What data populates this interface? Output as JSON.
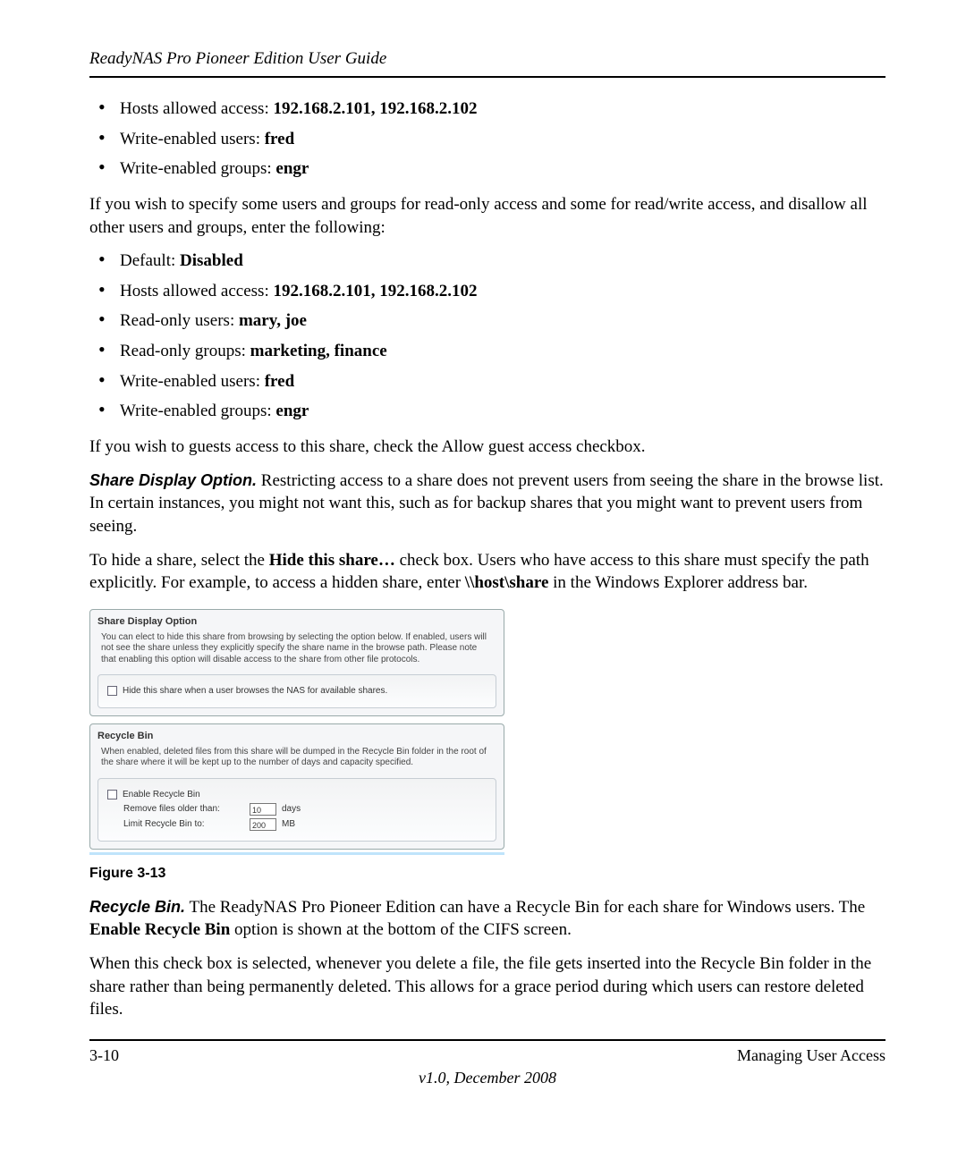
{
  "header": "ReadyNAS Pro Pioneer Edition User Guide",
  "list1": [
    {
      "label": "Hosts allowed access: ",
      "value": "192.168.2.101, 192.168.2.102"
    },
    {
      "label": "Write-enabled users: ",
      "value": "fred"
    },
    {
      "label": "Write-enabled groups: ",
      "value": "engr"
    }
  ],
  "para1": "If you wish to specify some users and groups for read-only access and some for read/write access, and disallow all other users and groups, enter the following:",
  "list2": [
    {
      "label": "Default: ",
      "value": "Disabled"
    },
    {
      "label": "Hosts allowed access: ",
      "value": "192.168.2.101, 192.168.2.102"
    },
    {
      "label": "Read-only users: ",
      "value": "mary, joe"
    },
    {
      "label": "Read-only groups: ",
      "value": "marketing, finance"
    },
    {
      "label": "Write-enabled users: ",
      "value": "fred"
    },
    {
      "label": "Write-enabled groups: ",
      "value": "engr"
    }
  ],
  "para2": "If you wish to guests access to this share, check the Allow guest access checkbox.",
  "share_head": "Share Display Option.",
  "share_body": " Restricting access to a share does not prevent users from seeing the share in the browse list. In certain instances, you might not want this, such as for backup shares that you might want to prevent users from seeing.",
  "hide_para_pre": "To hide a share, select the ",
  "hide_bold": "Hide this share…",
  "hide_para_mid": " check box. Users who have access to this share must specify the path explicitly. For example, to access a hidden share, enter ",
  "hide_path": "\\\\host\\share",
  "hide_para_post": " in the Windows Explorer address bar.",
  "figure": {
    "sdo_title": "Share Display Option",
    "sdo_desc": "You can elect to hide this share from browsing by selecting the option below. If enabled, users will not see the share unless they explicitly specify the share name in the browse path. Please note that enabling this option will disable access to the share from other file protocols.",
    "sdo_check": "Hide this share when a user browses the NAS for available shares.",
    "rb_title": "Recycle Bin",
    "rb_desc": "When enabled, deleted files from this share will be dumped in the Recycle Bin folder in the root of the share where it will be kept up to the number of days and capacity specified.",
    "rb_check": "Enable Recycle Bin",
    "rb_row1_label": "Remove files older than:",
    "rb_row1_val": "10",
    "rb_row1_unit": "days",
    "rb_row2_label": "Limit Recycle Bin to:",
    "rb_row2_val": "200",
    "rb_row2_unit": "MB"
  },
  "fig_caption": "Figure 3-13",
  "recycle_head": "Recycle Bin.",
  "recycle_body_pre": " The ReadyNAS Pro Pioneer Edition can have a Recycle Bin for each share for Windows users. The ",
  "recycle_bold": "Enable Recycle Bin",
  "recycle_body_post": " option is shown at the bottom of the CIFS screen.",
  "para_last": "When this check box is selected, whenever you delete a file, the file gets inserted into the Recycle Bin folder in the share rather than being permanently deleted. This allows for a grace period during which users can restore deleted files.",
  "footer_left": "3-10",
  "footer_right": "Managing User Access",
  "footer_center": "v1.0, December 2008"
}
